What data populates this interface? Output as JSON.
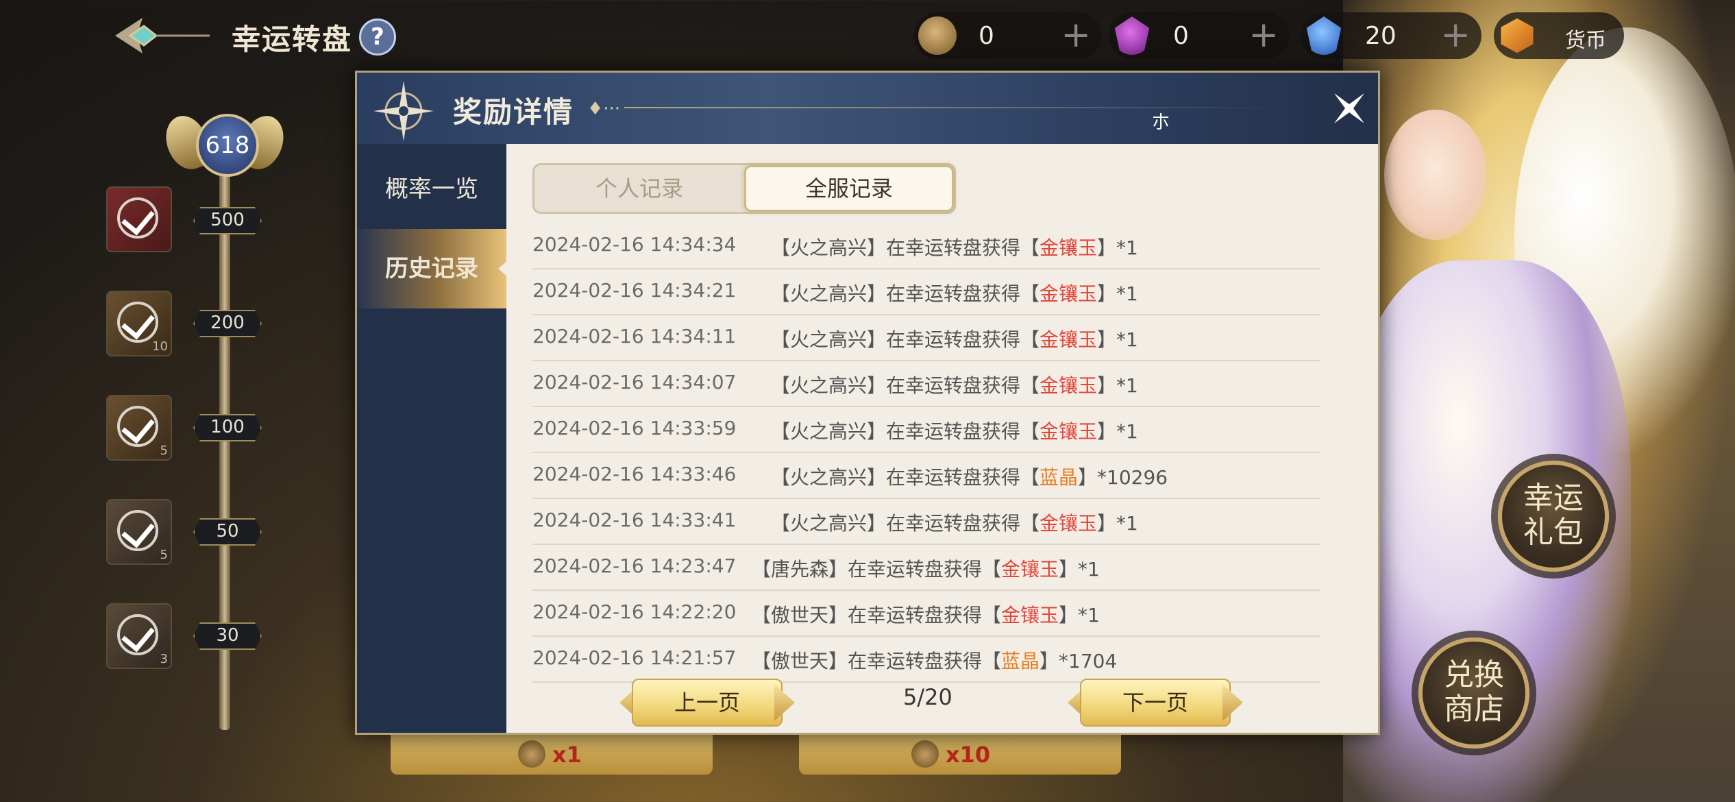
{
  "header": {
    "title": "幸运转盘",
    "help_icon": "?",
    "currencies": [
      {
        "icon": "coin-icon",
        "value": "0"
      },
      {
        "icon": "purple-gem-icon",
        "value": "0"
      },
      {
        "icon": "blue-crystal-icon",
        "value": "20"
      }
    ],
    "currency_label": "货币"
  },
  "progress": {
    "current": "618",
    "milestones": [
      {
        "value": "500",
        "count": ""
      },
      {
        "value": "200",
        "count": "10"
      },
      {
        "value": "100",
        "count": "5"
      },
      {
        "value": "50",
        "count": "5"
      },
      {
        "value": "30",
        "count": "3"
      }
    ]
  },
  "spin_buttons": [
    {
      "cost": "x1"
    },
    {
      "cost": "x10"
    }
  ],
  "side_buttons": {
    "gift": [
      "幸运",
      "礼包"
    ],
    "shop": [
      "兑换",
      "商店"
    ]
  },
  "dialog": {
    "title": "奖励详情",
    "title_deco": "♦···",
    "header_glyph": "朩",
    "tabs": [
      {
        "label": "概率一览",
        "active": false
      },
      {
        "label": "历史记录",
        "active": true
      }
    ],
    "segments": [
      {
        "label": "个人记录",
        "active": false
      },
      {
        "label": "全服记录",
        "active": true
      }
    ],
    "records": [
      {
        "time": "2024-02-16 14:34:34",
        "pre": "【火之高兴】在幸运转盘获得【",
        "item": "金镶玉",
        "post": "】*1"
      },
      {
        "time": "2024-02-16 14:34:21",
        "pre": "【火之高兴】在幸运转盘获得【",
        "item": "金镶玉",
        "post": "】*1"
      },
      {
        "time": "2024-02-16 14:34:11",
        "pre": "【火之高兴】在幸运转盘获得【",
        "item": "金镶玉",
        "post": "】*1"
      },
      {
        "time": "2024-02-16 14:34:07",
        "pre": "【火之高兴】在幸运转盘获得【",
        "item": "金镶玉",
        "post": "】*1"
      },
      {
        "time": "2024-02-16 14:33:59",
        "pre": "【火之高兴】在幸运转盘获得【",
        "item": "金镶玉",
        "post": "】*1"
      },
      {
        "time": "2024-02-16 14:33:46",
        "pre": "【火之高兴】在幸运转盘获得【",
        "item": "蓝晶",
        "post": "】*10296"
      },
      {
        "time": "2024-02-16 14:33:41",
        "pre": "【火之高兴】在幸运转盘获得【",
        "item": "金镶玉",
        "post": "】*1"
      },
      {
        "time": "2024-02-16 14:23:47",
        "pre": "【唐先森】在幸运转盘获得【",
        "item": "金镶玉",
        "post": "】*1"
      },
      {
        "time": "2024-02-16 14:22:20",
        "pre": "【傲世天】在幸运转盘获得【",
        "item": "金镶玉",
        "post": "】*1"
      },
      {
        "time": "2024-02-16 14:21:57",
        "pre": "【傲世天】在幸运转盘获得【",
        "item": "蓝晶",
        "post": "】*1704"
      }
    ],
    "pager": {
      "prev_label": "上一页",
      "next_label": "下一页",
      "page": "5/20"
    }
  },
  "colors": {
    "item_red": "#e2473c",
    "item_orange": "#e57e22",
    "panel_bg": "#f2eee6",
    "dialog_navy": "#223048"
  }
}
